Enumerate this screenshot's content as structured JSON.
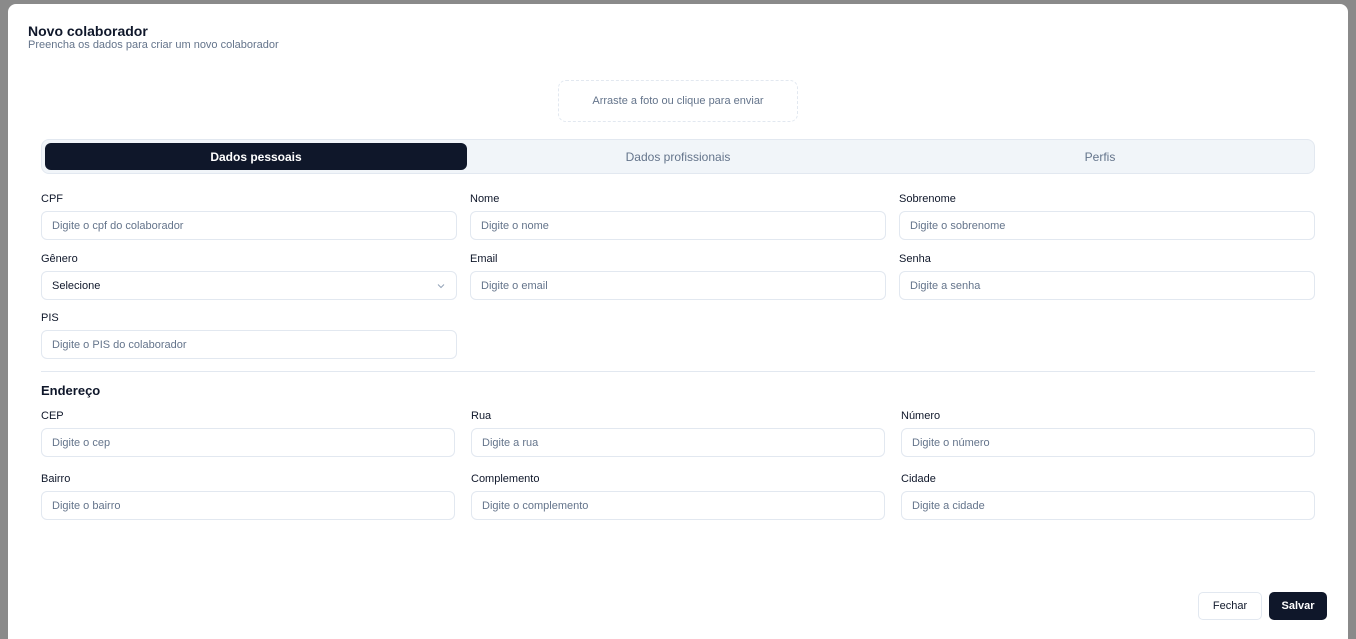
{
  "modal": {
    "title": "Novo colaborador",
    "subtitle": "Preencha os dados para criar um novo colaborador"
  },
  "photo_upload": {
    "label": "Arraste a foto ou clique para enviar"
  },
  "tabs": [
    {
      "label": "Dados pessoais",
      "active": true
    },
    {
      "label": "Dados profissionais",
      "active": false
    },
    {
      "label": "Perfis",
      "active": false
    }
  ],
  "personal": {
    "cpf": {
      "label": "CPF",
      "placeholder": "Digite o cpf do colaborador",
      "value": ""
    },
    "nome": {
      "label": "Nome",
      "placeholder": "Digite o nome",
      "value": ""
    },
    "sobrenome": {
      "label": "Sobrenome",
      "placeholder": "Digite o sobrenome",
      "value": ""
    },
    "genero": {
      "label": "Gênero",
      "selected": "Selecione"
    },
    "email": {
      "label": "Email",
      "placeholder": "Digite o email",
      "value": ""
    },
    "senha": {
      "label": "Senha",
      "placeholder": "Digite a senha",
      "value": ""
    },
    "pis": {
      "label": "PIS",
      "placeholder": "Digite o PIS do colaborador",
      "value": ""
    }
  },
  "address": {
    "title": "Endereço",
    "cep": {
      "label": "CEP",
      "placeholder": "Digite o cep",
      "value": ""
    },
    "rua": {
      "label": "Rua",
      "placeholder": "Digite a rua",
      "value": ""
    },
    "numero": {
      "label": "Número",
      "placeholder": "Digite o número",
      "value": ""
    },
    "bairro": {
      "label": "Bairro",
      "placeholder": "Digite o bairro",
      "value": ""
    },
    "complemento": {
      "label": "Complemento",
      "placeholder": "Digite o complemento",
      "value": ""
    },
    "cidade": {
      "label": "Cidade",
      "placeholder": "Digite a cidade",
      "value": ""
    }
  },
  "footer": {
    "close_label": "Fechar",
    "save_label": "Salvar"
  },
  "colors": {
    "primary": "#0f172a",
    "muted": "#64748b",
    "border": "#e2e8f0",
    "tab_bg": "#f1f5f9",
    "backdrop": "#8a8a8a"
  },
  "icons": {
    "select_chevron": "chevron-down-icon"
  }
}
